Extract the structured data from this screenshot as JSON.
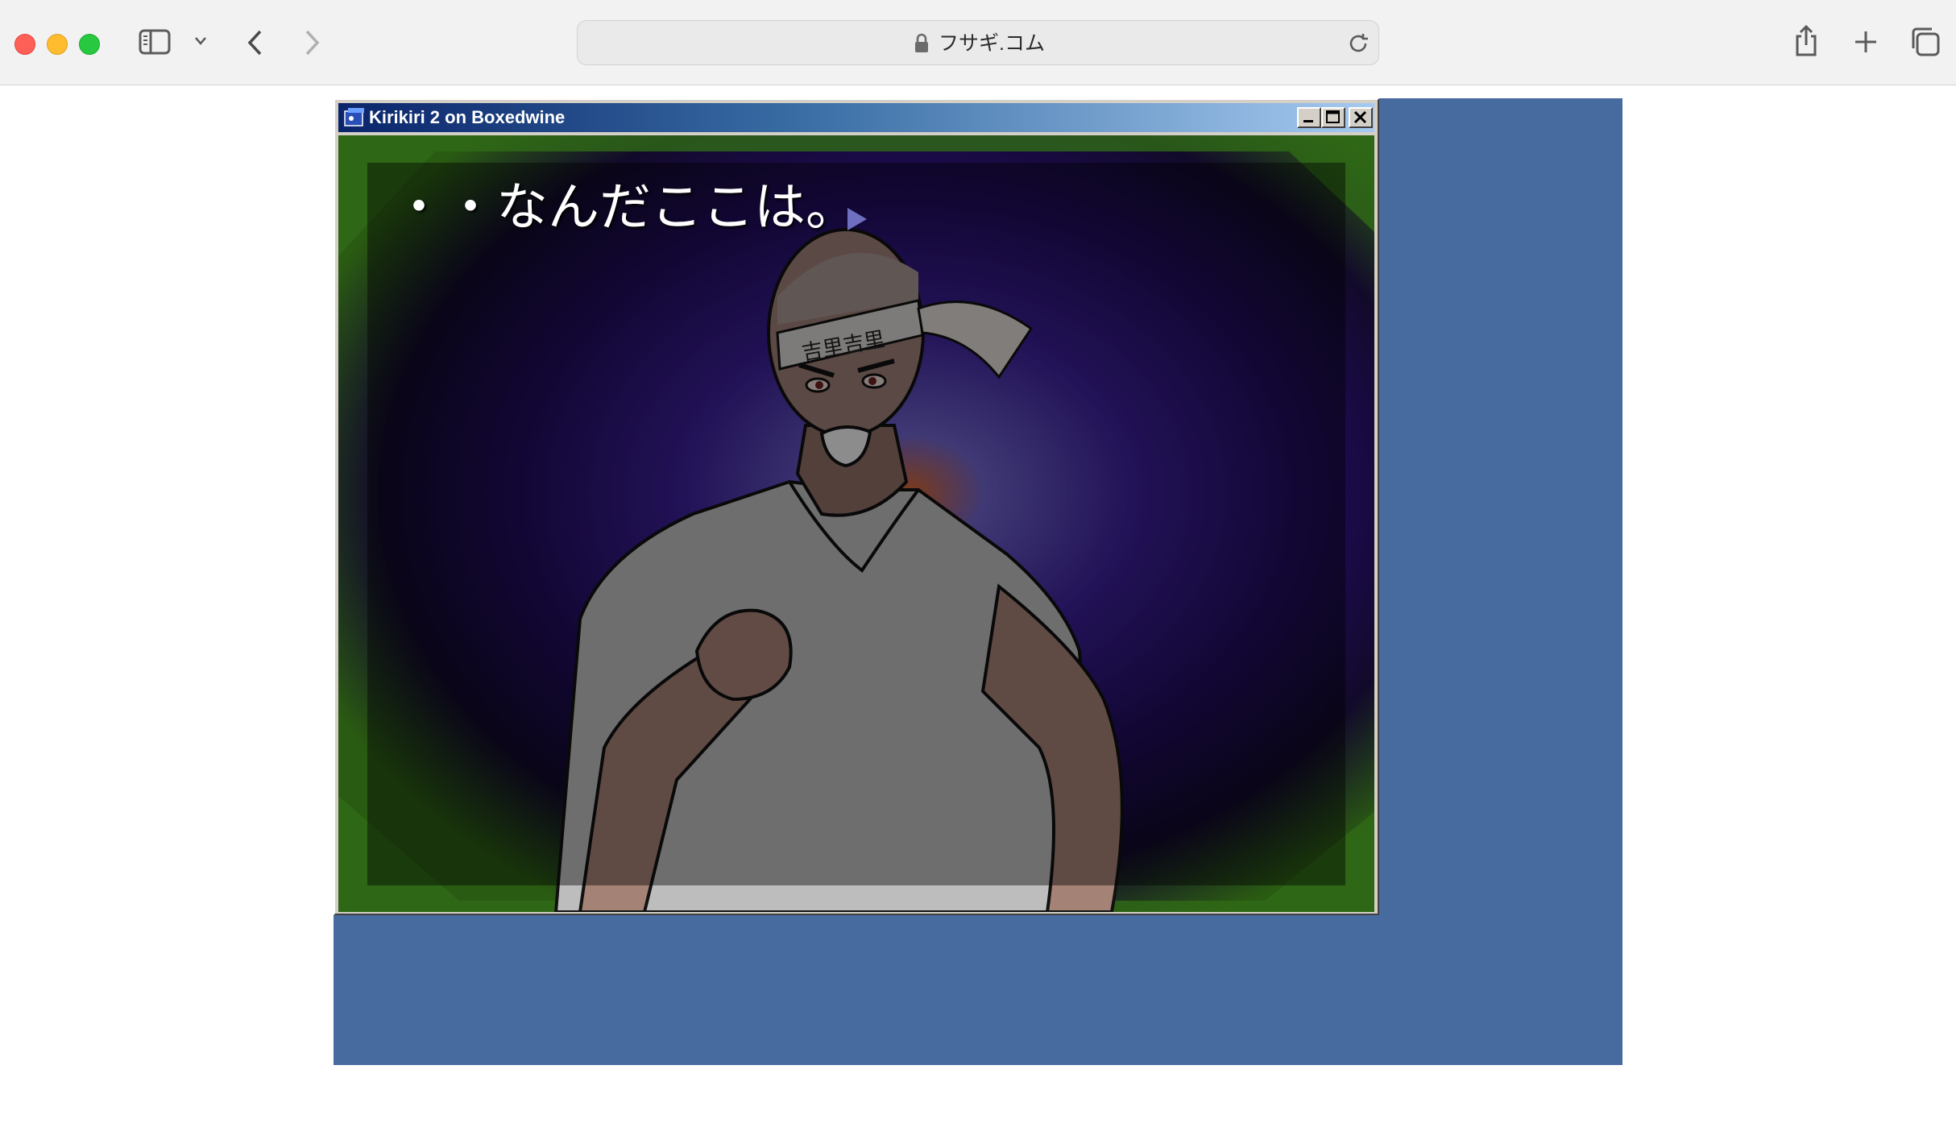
{
  "browser": {
    "url": "フサギ.コム",
    "icons": {
      "sidebar": "sidebar-icon",
      "sidebar_menu": "chevron-down-icon",
      "back": "chevron-left-icon",
      "forward": "chevron-right-icon",
      "lock": "lock-icon",
      "reload": "reload-icon",
      "share": "share-icon",
      "new_tab": "plus-icon",
      "tab_overview": "tabs-icon"
    }
  },
  "emulator": {
    "background_color": "#486b9f",
    "window": {
      "title": "Kirikiri 2 on Boxedwine",
      "controls": [
        "minimize",
        "maximize",
        "close"
      ]
    },
    "game": {
      "dialogue": "・・なんだここは。",
      "headband_text": "吉里吉里"
    }
  }
}
